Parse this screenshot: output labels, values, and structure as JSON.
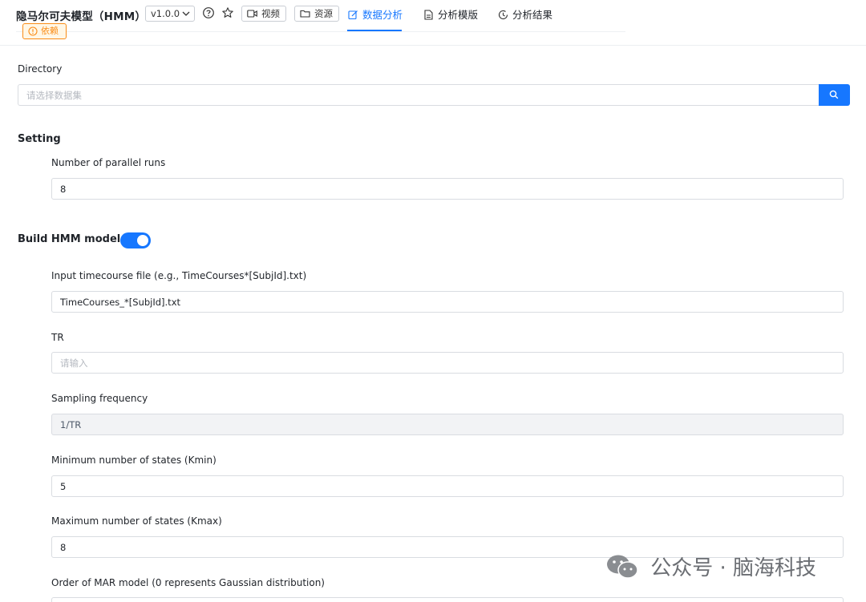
{
  "header": {
    "title": "隐马尔可夫模型（HMM）",
    "version": "v1.0.0",
    "video_label": "视频",
    "resource_label": "资源",
    "tabs": [
      {
        "label": "数据分析",
        "active": true
      },
      {
        "label": "分析模版",
        "active": false
      },
      {
        "label": "分析结果",
        "active": false
      }
    ],
    "dependency_badge": "依赖"
  },
  "directory": {
    "label": "Directory",
    "placeholder": "请选择数据集"
  },
  "setting": {
    "title": "Setting",
    "parallel_runs_label": "Number of parallel runs",
    "parallel_runs_value": "8"
  },
  "build": {
    "title": "Build HMM model",
    "enabled": true,
    "timecourse_label": "Input timecourse file (e.g., TimeCourses*[SubjId].txt)",
    "timecourse_value": "TimeCourses_*[SubjId].txt",
    "tr_label": "TR",
    "tr_placeholder": "请输入",
    "sampling_label": "Sampling frequency",
    "sampling_value": "1/TR",
    "kmin_label": "Minimum number of states (Kmin)",
    "kmin_value": "5",
    "kmax_label": "Maximum number of states (Kmax)",
    "kmax_value": "8",
    "mar_label": "Order of MAR model (0 represents Gaussian distribution)"
  },
  "watermark": {
    "text": "公众号 · 脑海科技"
  },
  "colors": {
    "accent": "#1677ff",
    "warning": "#fa8c16"
  }
}
